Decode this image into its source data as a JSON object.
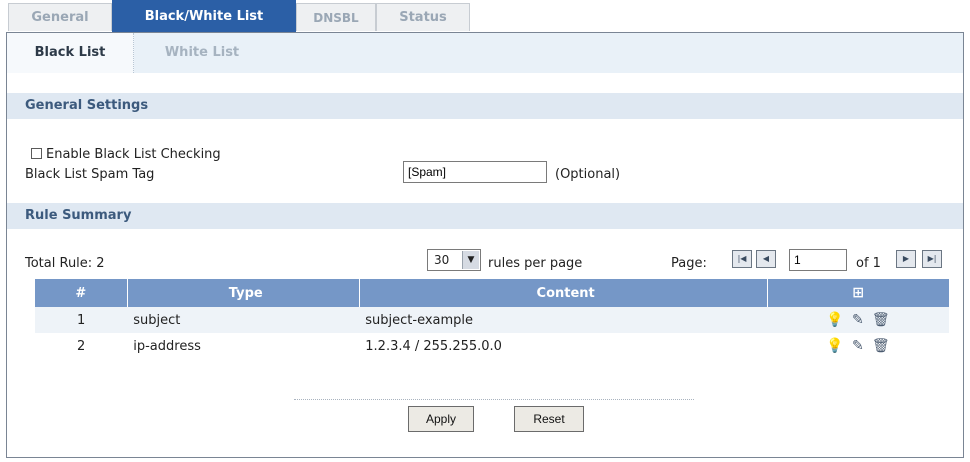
{
  "tabs": {
    "general": "General",
    "black_white": "Black/White List",
    "dnsbl": "DNSBL",
    "status": "Status"
  },
  "sub_tabs": {
    "black_list": "Black List",
    "white_list": "White List"
  },
  "general_settings": {
    "title": "General Settings",
    "enable_checkbox_label": "Enable Black List Checking",
    "enable_checked": false,
    "spam_tag_label": "Black List Spam Tag",
    "spam_tag_value": "[Spam]",
    "optional_label": "(Optional)"
  },
  "rule_summary": {
    "title": "Rule Summary",
    "total_rule": "Total Rule: 2",
    "rules_per_page_value": "30",
    "rules_per_page_label": "rules per page",
    "page_label": "Page:",
    "page_value": "1",
    "page_of": "of 1",
    "columns": {
      "num": "#",
      "type": "Type",
      "content": "Content"
    },
    "rows": [
      {
        "num": "1",
        "type": "subject",
        "content": "subject-example"
      },
      {
        "num": "2",
        "type": "ip-address",
        "content": "1.2.3.4 / 255.255.0.0"
      }
    ]
  },
  "buttons": {
    "apply": "Apply",
    "reset": "Reset"
  },
  "colors": {
    "active_tab": "#2b5fa6",
    "table_header": "#7597c7",
    "section_bar": "#dfe8f2"
  }
}
